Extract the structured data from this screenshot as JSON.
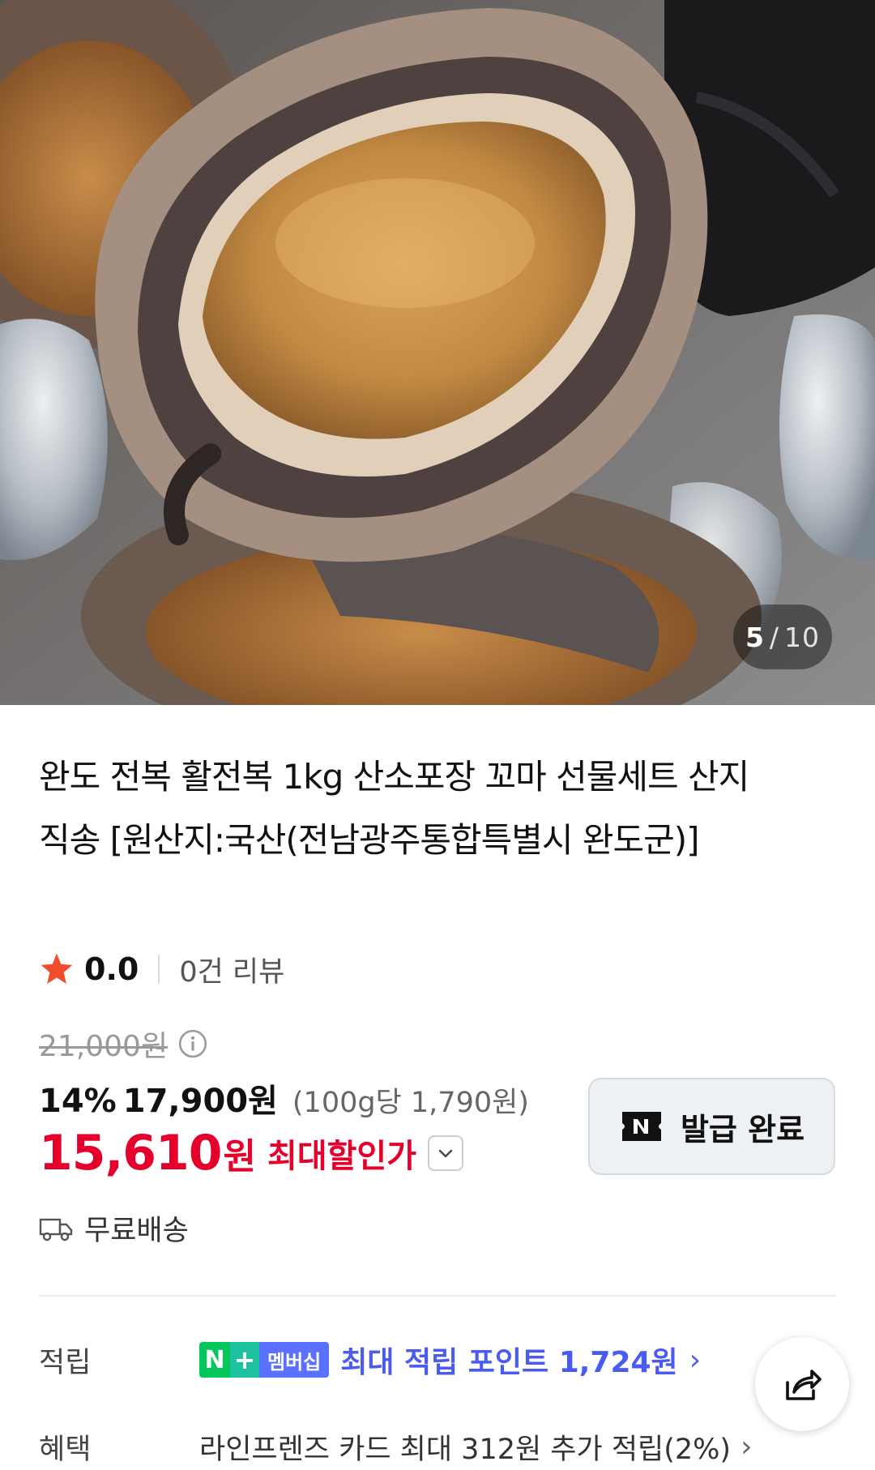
{
  "gallery": {
    "current": "5",
    "separator": "/",
    "total": "10",
    "image_subject": "abalone-photo"
  },
  "product": {
    "title": "완도 전복 활전복 1kg 산소포장 꼬마 선물세트 산지직송 [원산지:국산(전남광주통합특별시 완도군)]",
    "rating": "0.0",
    "review_count": "0건 리뷰",
    "original_price": "21,000원",
    "discount_percent": "14%",
    "sale_price": "17,900원",
    "unit_price": "(100g당 1,790원)",
    "max_discount_price": "15,610",
    "max_discount_won": "원",
    "max_discount_label": "최대할인가"
  },
  "coupon": {
    "label": "발급 완료"
  },
  "delivery": {
    "label": "무료배송"
  },
  "points": {
    "key": "적립",
    "badge_n": "N",
    "badge_plus": "+",
    "badge_membership": "멤버십",
    "text": "최대 적립 포인트 1,724원",
    "arrow": "›"
  },
  "benefit": {
    "key": "혜택",
    "text": "라인프렌즈 카드 최대 312원 추가 적립(2%)",
    "arrow": "›"
  },
  "colors": {
    "sale_red": "#e5002c",
    "naver_green": "#03c75a",
    "points_blue": "#4a5cf0",
    "star": "#f04d2e"
  }
}
